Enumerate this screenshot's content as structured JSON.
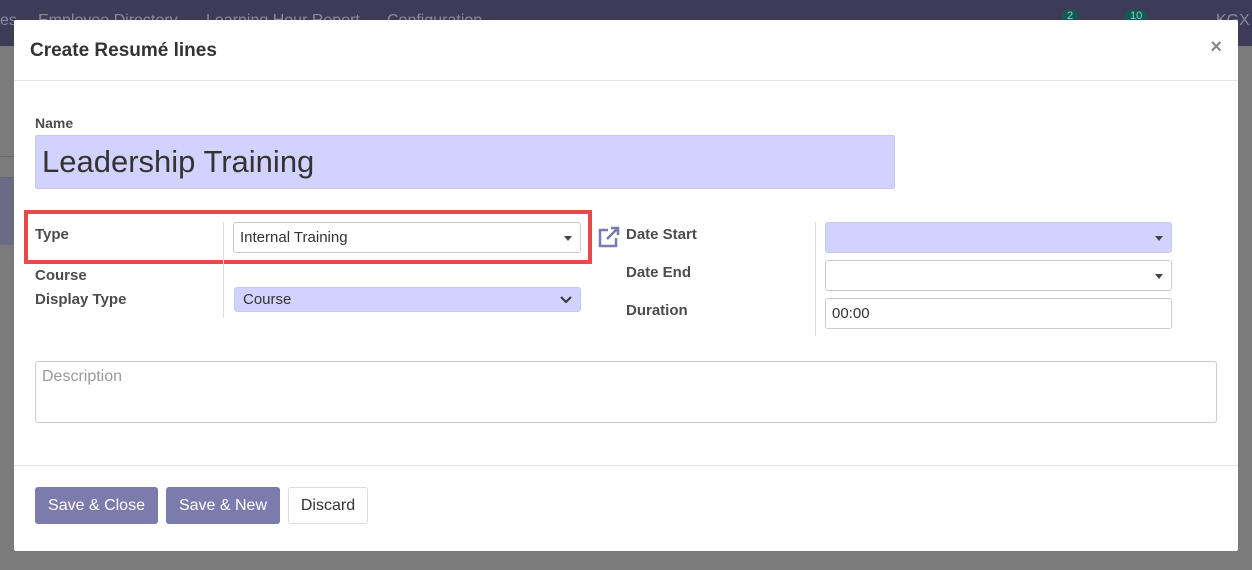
{
  "topbar": {
    "items": [
      "es",
      "Employee Directory",
      "Learning Hour Report",
      "Configuration"
    ],
    "activity_count": "2",
    "message_count": "10",
    "user": "KGX"
  },
  "modal": {
    "title": "Create Resumé lines",
    "close_icon": "close-icon",
    "name": {
      "label": "Name",
      "value": "Leadership Training"
    },
    "type": {
      "label": "Type",
      "value": "Internal Training",
      "highlight_color": "#e84a4a"
    },
    "course_display_type": {
      "label_line1": "Course",
      "label_line2": "Display Type",
      "value": "Course"
    },
    "date_start": {
      "label": "Date Start",
      "value": ""
    },
    "date_end": {
      "label": "Date End",
      "value": ""
    },
    "duration": {
      "label": "Duration",
      "value": "00:00"
    },
    "description": {
      "placeholder": "Description"
    },
    "buttons": {
      "save_close": "Save & Close",
      "save_new": "Save & New",
      "discard": "Discard"
    }
  },
  "colors": {
    "required_field": "#d2d2ff",
    "primary_button": "#7c7bad",
    "external_link_icon": "#7c7bad"
  }
}
